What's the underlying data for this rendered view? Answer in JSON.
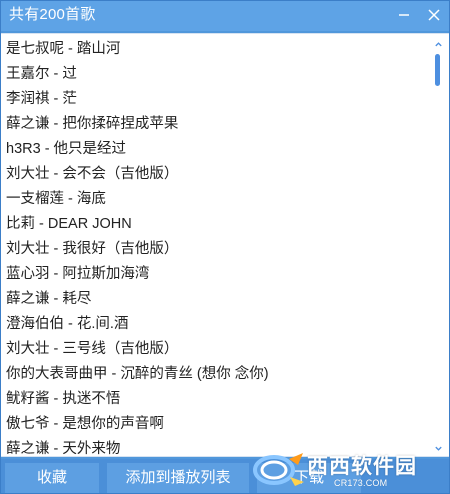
{
  "window": {
    "title": "共有200首歌"
  },
  "title_controls": {
    "minimize_icon": "minimize-icon",
    "close_icon": "close-icon"
  },
  "songs": [
    "是七叔呢 - 踏山河",
    "王嘉尔 - 过",
    "李润祺 - 茫",
    "薛之谦 - 把你揉碎捏成苹果",
    "h3R3 - 他只是经过",
    "刘大壮 - 会不会（吉他版）",
    "一支榴莲 - 海底",
    "比莉 - DEAR JOHN",
    "刘大壮 - 我很好（吉他版）",
    "蓝心羽 - 阿拉斯加海湾",
    "薛之谦 - 耗尽",
    "澄海伯伯 - 花.间.酒",
    "刘大壮 - 三号线（吉他版）",
    "你的大表哥曲甲 - 沉醉的青丝 (想你 念你)",
    "鱿籽酱 - 执迷不悟",
    "傲七爷 - 是想你的声音啊",
    "薛之谦 - 天外来物"
  ],
  "scrollbar": {
    "position": 0
  },
  "buttons": {
    "collect": "收藏",
    "add_to_playlist": "添加到播放列表",
    "download": "下载"
  },
  "watermark": {
    "main": "西西软件园",
    "sub": "CR173.COM"
  },
  "colors": {
    "accent": "#5097db",
    "titlebar": "#5ea3e6",
    "button": "#5d9fe2",
    "scroll_thumb": "#4d8fe0",
    "text": "#222222"
  }
}
